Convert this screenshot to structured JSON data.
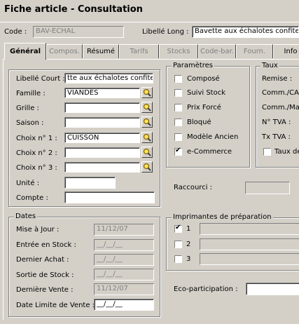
{
  "window": {
    "title": "Fiche article - Consultation"
  },
  "header": {
    "code_label": "Code :",
    "code_value": "BAV-ECHAL",
    "libelle_long_label": "Libellé Long :",
    "libelle_long_value": "Bavette aux échalotes confites"
  },
  "tabs": [
    {
      "label": "Général",
      "active": true
    },
    {
      "label": "Compos.",
      "active": false
    },
    {
      "label": "Résumé",
      "active": false
    },
    {
      "label": "Tarifs",
      "active": false
    },
    {
      "label": "Stocks",
      "active": false
    },
    {
      "label": "Code-bar.",
      "active": false
    },
    {
      "label": "Fourn.",
      "active": false
    },
    {
      "label": "Info",
      "active": false
    }
  ],
  "general": {
    "libelle_court_label": "Libellé Court :",
    "libelle_court_value": "tte aux échalotes confites",
    "famille_label": "Famille :",
    "famille_value": "VIANDES",
    "grille_label": "Grille :",
    "grille_value": "",
    "saison_label": "Saison :",
    "saison_value": "",
    "choix1_label": "Choix n° 1 :",
    "choix1_value": "CUISSON",
    "choix2_label": "Choix n° 2 :",
    "choix2_value": "",
    "choix3_label": "Choix n° 3 :",
    "choix3_value": "",
    "unite_label": "Unité :",
    "unite_value": "",
    "compte_label": "Compte :",
    "compte_value": ""
  },
  "dates": {
    "title": "Dates",
    "mise_a_jour_label": "Mise à Jour :",
    "mise_a_jour_value": "11/12/07",
    "entree_stock_label": "Entrée en Stock :",
    "entree_stock_value": "__/__/__",
    "dernier_achat_label": "Dernier Achat :",
    "dernier_achat_value": "__/__/__",
    "sortie_stock_label": "Sortie de Stock :",
    "sortie_stock_value": "__/__/__",
    "derniere_vente_label": "Dernière Vente :",
    "derniere_vente_value": "11/12/07",
    "date_limite_label": "Date Limite de Vente :",
    "date_limite_value": "__/__/__"
  },
  "parametres": {
    "title": "Paramètres",
    "items": [
      {
        "label": "Composé",
        "checked": false
      },
      {
        "label": "Suivi Stock",
        "checked": false
      },
      {
        "label": "Prix Forcé",
        "checked": false
      },
      {
        "label": "Bloqué",
        "checked": false
      },
      {
        "label": "Modèle Ancien",
        "checked": false
      },
      {
        "label": "e-Commerce",
        "checked": true
      }
    ]
  },
  "taux": {
    "title": "Taux",
    "remise_label": "Remise :",
    "comm_ca_label": "Comm./CA",
    "comm_ma_label": "Comm./Ma",
    "ntva_label": "N° TVA :",
    "txtva_label": "Tx TVA :",
    "taux_de_label": "Taux de"
  },
  "raccourci": {
    "label": "Raccourci :",
    "value": ""
  },
  "imprimantes": {
    "title": "Imprimantes de préparation",
    "items": [
      {
        "number": "1",
        "checked": true
      },
      {
        "number": "2",
        "checked": false
      },
      {
        "number": "3",
        "checked": false
      }
    ]
  },
  "eco": {
    "label": "Eco-participation :",
    "value": ""
  },
  "icons": {
    "search": "search-icon"
  }
}
